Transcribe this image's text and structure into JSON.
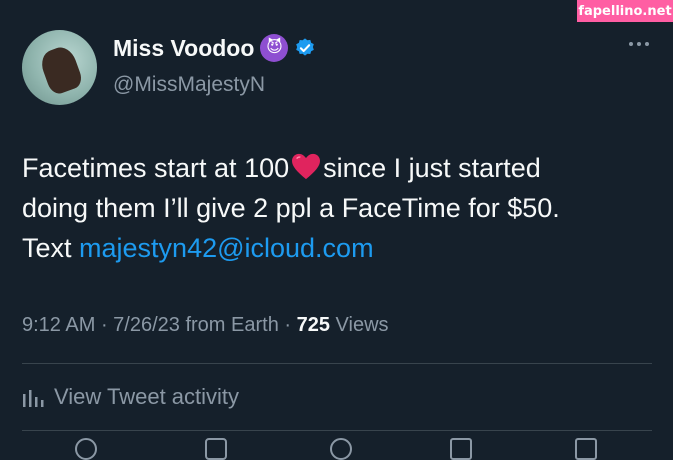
{
  "watermark": "fapellino.net",
  "author": {
    "display_name": "Miss Voodoo",
    "name_emoji": "😈",
    "handle": "@MissMajestyN",
    "verified": true
  },
  "tweet": {
    "line1_before_emoji": "Facetimes start at 100",
    "emoji": "heart",
    "line1_after_emoji": "since I just started",
    "line2": "doing them I’ll give 2 ppl a FaceTime for $50.",
    "line3_prefix": "Text ",
    "email": "majestyn42@icloud.com"
  },
  "meta": {
    "time": "9:12 AM",
    "separator1": " · ",
    "date": "7/26/23",
    "source": " from Earth",
    "separator2": " · ",
    "views_count": "725",
    "views_label": " Views"
  },
  "activity": {
    "label": "View Tweet activity"
  },
  "colors": {
    "background": "#15202b",
    "accent": "#1d9bf0",
    "muted": "#8b98a5",
    "watermark": "#ff5ea3"
  }
}
